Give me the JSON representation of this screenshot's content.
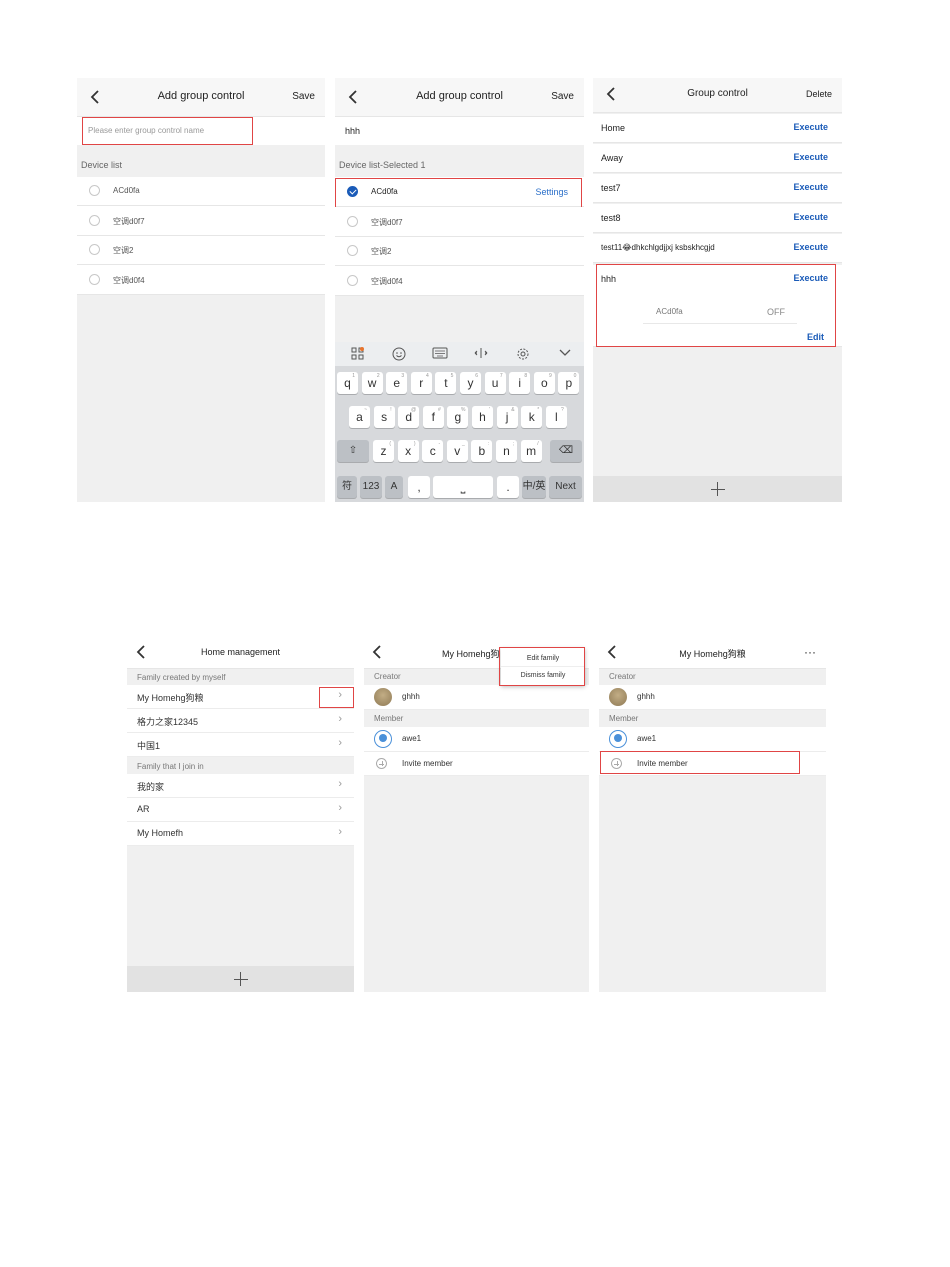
{
  "s1": {
    "title": "Add group control",
    "back": "back",
    "save": "Save",
    "name_placeholder": "Please enter group control name",
    "device_list_label": "Device list",
    "devices": [
      "ACd0fa",
      "空调d0f7",
      "空调2",
      "空调d0f4"
    ]
  },
  "s2": {
    "title": "Add group control",
    "save": "Save",
    "name_value": "hhh",
    "device_list_label": "Device list-Selected 1",
    "devices": [
      "ACd0fa",
      "空调d0f7",
      "空调2",
      "空调d0f4"
    ],
    "settings": "Settings",
    "keyboard": {
      "row1": [
        "q",
        "w",
        "e",
        "r",
        "t",
        "y",
        "u",
        "i",
        "o",
        "p"
      ],
      "row1_hints": [
        "1",
        "2",
        "3",
        "4",
        "5",
        "6",
        "7",
        "8",
        "9",
        "0"
      ],
      "row2": [
        "a",
        "s",
        "d",
        "f",
        "g",
        "h",
        "j",
        "k",
        "l"
      ],
      "row2_hints": [
        "~",
        "!",
        "@",
        "#",
        "%",
        "'",
        "&",
        "*",
        "?"
      ],
      "row3": [
        "z",
        "x",
        "c",
        "v",
        "b",
        "n",
        "m"
      ],
      "row3_hints": [
        "(",
        ")",
        "-",
        "_",
        ":",
        ";",
        "/"
      ],
      "sym": "符",
      "num": "123",
      "comma": ",",
      "period": ".",
      "lang": "中/英",
      "next": "Next"
    }
  },
  "s3": {
    "title": "Group control",
    "delete": "Delete",
    "execute": "Execute",
    "groups": [
      "Home",
      "Away",
      "test7",
      "test8",
      "test11😂dhkchlgdjjxj ksbskhcgjd",
      "hhh"
    ],
    "device": "ACd0fa",
    "state": "OFF",
    "edit": "Edit"
  },
  "s4": {
    "title": "Home management",
    "created_label": "Family created by myself",
    "created": [
      "My Homehg狗粮",
      "格力之家12345",
      "中国1"
    ],
    "joined_label": "Family that I join in",
    "joined": [
      "我的家",
      "AR",
      "My Homefh"
    ]
  },
  "s5": {
    "title": "My Homehg狗",
    "creator_label": "Creator",
    "creator": "ghhh",
    "member_label": "Member",
    "member": "awe1",
    "invite": "Invite member",
    "menu": [
      "Edit family",
      "Dismiss family"
    ]
  },
  "s6": {
    "title": "My Homehg狗粮",
    "more": "···",
    "creator_label": "Creator",
    "creator": "ghhh",
    "member_label": "Member",
    "member": "awe1",
    "invite": "Invite member"
  },
  "colors": {
    "accent": "#1a5bb8",
    "highlight": "#e04545",
    "bg": "#f0f0f0"
  }
}
